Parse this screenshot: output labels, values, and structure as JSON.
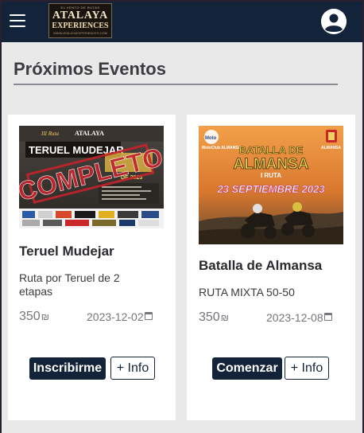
{
  "header": {
    "menu_icon": "hamburger-menu-icon",
    "logo": {
      "small_top": "EL VENTO DE RUTAS",
      "line1": "ATALAYA",
      "line2": "EXPERIENCES",
      "url": "WWW.ATALAYAEXPERIENCES.COM"
    },
    "account_icon": "account-circle-icon"
  },
  "page": {
    "title": "Próximos Eventos"
  },
  "events": [
    {
      "title": "Teruel Mudejar",
      "description": "Ruta por Teruel de 2 etapas",
      "price": "350",
      "price_icon": "₪",
      "date": "2023-12-02",
      "primary_label": "Inscribirme",
      "info_label": "+ Info",
      "poster": {
        "edition": "III Ruta",
        "brand": "ATALAYA",
        "headline": "TERUEL MUDEJAR",
        "stamp": "COMPLETO",
        "date_text": "DE 2023"
      }
    },
    {
      "title": "Batalla de Almansa",
      "description": "RUTA MIXTA 50-50",
      "price": "350",
      "price_icon": "₪",
      "date": "2023-12-08",
      "primary_label": "Comenzar",
      "info_label": "+ Info",
      "poster": {
        "left_logo": "MotoClub ALMANSA",
        "right_logo": "ALMANSA",
        "headline1": "BATALLA DE",
        "headline2": "ALMANSA",
        "subhead": "I RUTA",
        "date_text": "23 SEPTIEMBRE 2023"
      }
    }
  ],
  "colors": {
    "navy": "#13243a",
    "page_bg": "#e9e9ea",
    "stamp_red": "#c3242b",
    "almansa_yellow": "#f2d24a",
    "date_magenta": "#c8287a"
  }
}
